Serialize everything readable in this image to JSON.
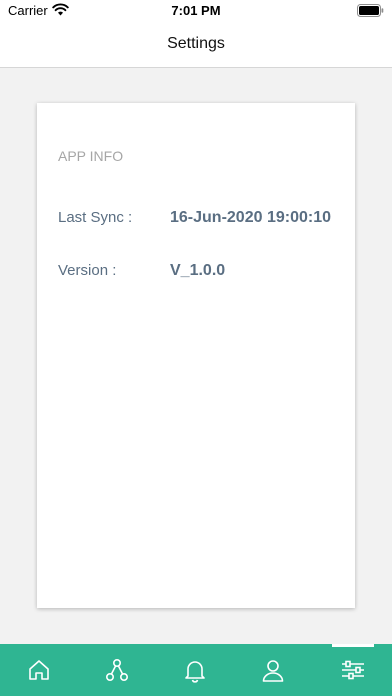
{
  "status_bar": {
    "carrier": "Carrier",
    "time": "7:01 PM",
    "icons": [
      "wifi-icon",
      "battery-icon"
    ]
  },
  "nav": {
    "title": "Settings"
  },
  "app_info": {
    "section_title": "APP INFO",
    "rows": [
      {
        "label": "Last Sync :",
        "value": "16-Jun-2020 19:00:10"
      },
      {
        "label": "Version :",
        "value": "V_1.0.0"
      }
    ]
  },
  "tab_bar": {
    "accent_color": "#2fb592",
    "items": [
      {
        "icon": "home-icon",
        "active": false
      },
      {
        "icon": "network-icon",
        "active": false
      },
      {
        "icon": "bell-icon",
        "active": false
      },
      {
        "icon": "user-icon",
        "active": false
      },
      {
        "icon": "sliders-icon",
        "active": true
      }
    ]
  }
}
